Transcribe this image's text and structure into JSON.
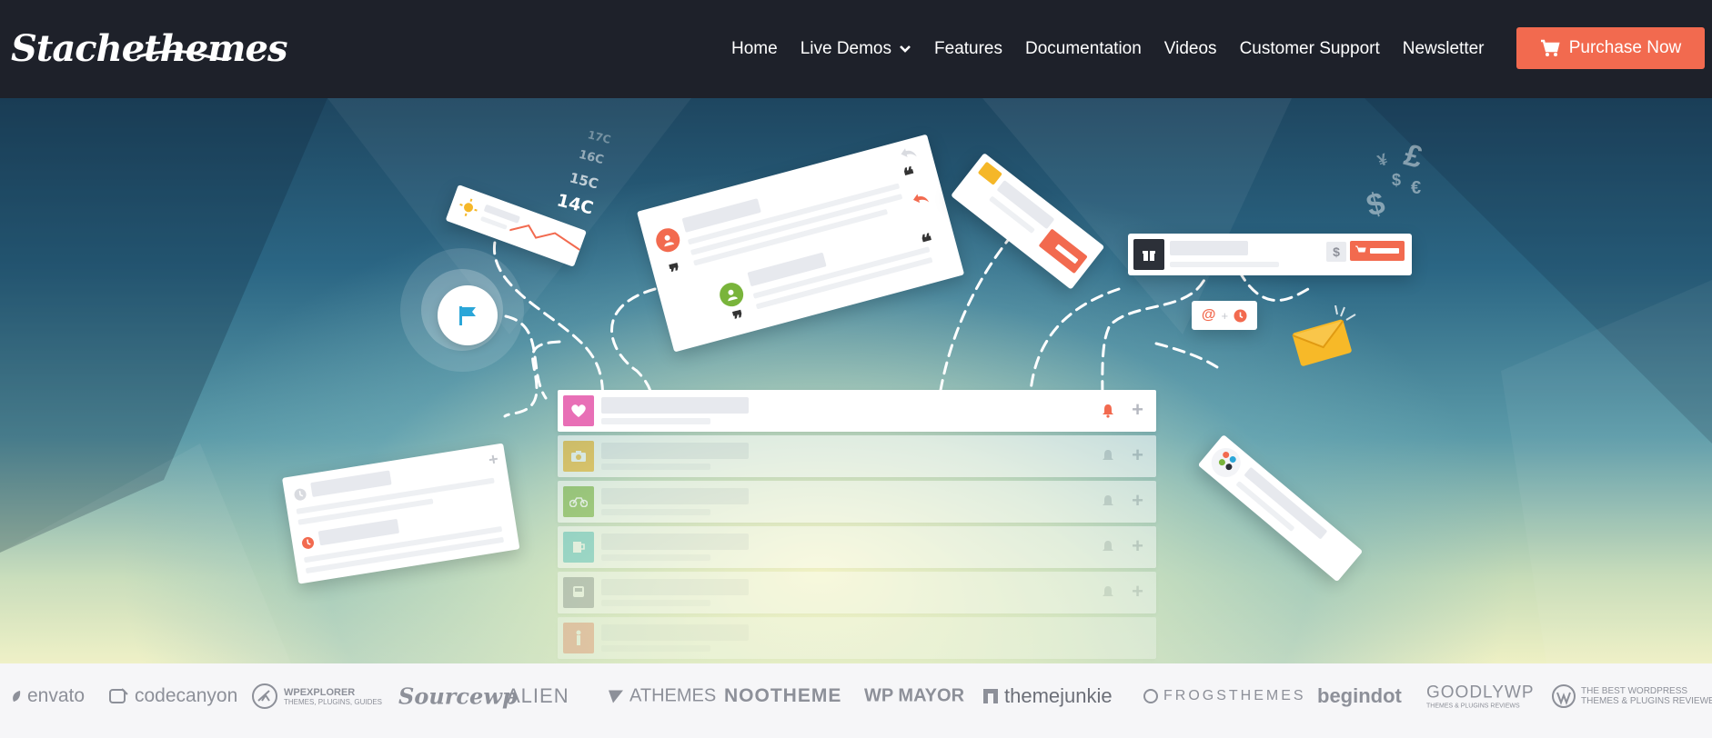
{
  "header": {
    "logo": "Stachethemes",
    "nav": [
      {
        "label": "Home"
      },
      {
        "label": "Live Demos",
        "has_dropdown": true
      },
      {
        "label": "Features"
      },
      {
        "label": "Documentation"
      },
      {
        "label": "Videos"
      },
      {
        "label": "Customer Support"
      },
      {
        "label": "Newsletter"
      }
    ],
    "cta_label": "Purchase Now",
    "cta_color": "#f26a4f",
    "bg_color": "#1e212a"
  },
  "hero": {
    "temperatures": [
      "17C",
      "16C",
      "15C",
      "14C"
    ],
    "currency_symbols": [
      "¥",
      "£",
      "$",
      "€",
      "$"
    ],
    "notify_symbols": [
      "@",
      "+"
    ]
  },
  "partners": {
    "envato": "envato",
    "codecanyon": "codecanyon",
    "wpexplorer": "WPEXPLORER",
    "wpexplorer_tag": "THEMES, PLUGINS, GUIDES",
    "sourcewp": "Sourcewp",
    "alien": "ALIEN",
    "athemes": "ATHEMES",
    "nootheme": "NOOTHEME",
    "wpmayor": "WP MAYOR",
    "themejunkie": "themejunkie",
    "frogsthemes": "FROGSTHEMES",
    "begindot": "begindot",
    "goodlywp": "GOODLYWP",
    "goodlywp_tag": "THEMES & PLUGINS REVIEWS",
    "bestwp_line1": "THE BEST WORDPRESS",
    "bestwp_line2": "THEMES & PLUGINS REVIEWED"
  }
}
